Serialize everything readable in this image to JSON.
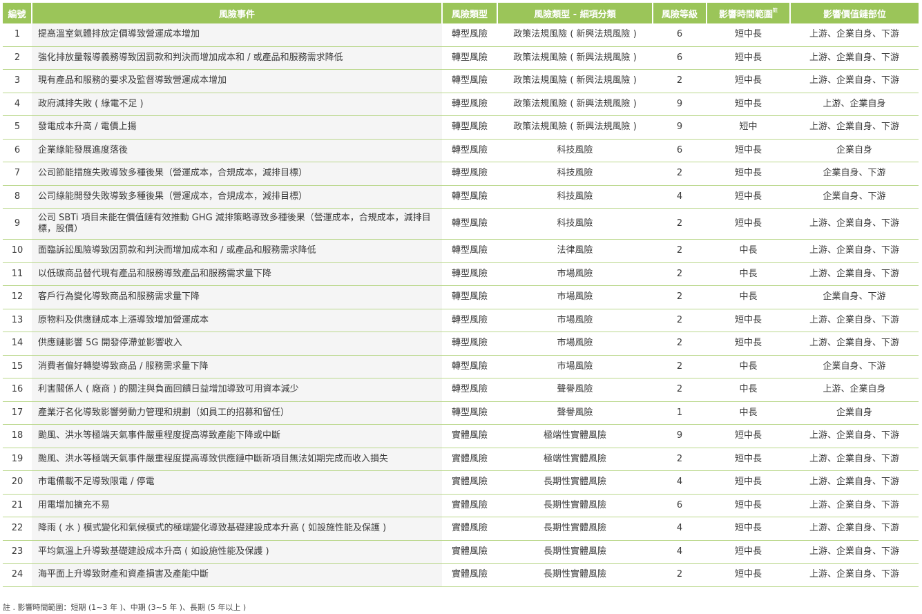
{
  "table": {
    "headers": {
      "no": "編號",
      "event": "風險事件",
      "type": "風險類型",
      "subtype": "風險類型 - 細項分類",
      "level": "風險等級",
      "time": "影響時間範圍",
      "time_mark": "註",
      "chain": "影響價值鏈部位"
    },
    "rows": [
      {
        "no": "1",
        "event": "提高溫室氣體排放定價導致營運成本增加",
        "type": "轉型風險",
        "subtype": "政策法規風險 ( 新興法規風險 )",
        "level": "6",
        "time": "短中長",
        "chain": "上游、企業自身、下游"
      },
      {
        "no": "2",
        "event": "強化排放量報導義務導致因罰款和判決而增加成本和 / 或產品和服務需求降低",
        "type": "轉型風險",
        "subtype": "政策法規風險 ( 新興法規風險 )",
        "level": "6",
        "time": "短中長",
        "chain": "上游、企業自身、下游"
      },
      {
        "no": "3",
        "event": "現有產品和服務的要求及監督導致營運成本增加",
        "type": "轉型風險",
        "subtype": "政策法規風險 ( 新興法規風險 )",
        "level": "2",
        "time": "短中長",
        "chain": "上游、企業自身、下游"
      },
      {
        "no": "4",
        "event": "政府減排失敗 ( 綠電不足 )",
        "type": "轉型風險",
        "subtype": "政策法規風險 ( 新興法規風險 )",
        "level": "9",
        "time": "短中長",
        "chain": "上游、企業自身"
      },
      {
        "no": "5",
        "event": "發電成本升高 / 電價上揚",
        "type": "轉型風險",
        "subtype": "政策法規風險 ( 新興法規風險 )",
        "level": "9",
        "time": "短中",
        "chain": "上游、企業自身、下游"
      },
      {
        "no": "6",
        "event": "企業綠能發展進度落後",
        "type": "轉型風險",
        "subtype": "科技風險",
        "level": "6",
        "time": "短中長",
        "chain": "企業自身"
      },
      {
        "no": "7",
        "event": "公司節能措施失敗導致多種後果（營運成本，合規成本，減排目標）",
        "type": "轉型風險",
        "subtype": "科技風險",
        "level": "2",
        "time": "短中長",
        "chain": "企業自身、下游"
      },
      {
        "no": "8",
        "event": "公司綠能開發失敗導致多種後果（營運成本，合規成本，減排目標）",
        "type": "轉型風險",
        "subtype": "科技風險",
        "level": "4",
        "time": "短中長",
        "chain": "企業自身、下游"
      },
      {
        "no": "9",
        "event": "公司 SBTi 項目未能在價值鏈有效推動 GHG 減排策略導致多種後果（營運成本，合規成本，減排目標，股價）",
        "type": "轉型風險",
        "subtype": "科技風險",
        "level": "2",
        "time": "短中長",
        "chain": "上游、企業自身、下游"
      },
      {
        "no": "10",
        "event": "面臨訴訟風險導致因罰款和判決而增加成本和 / 或產品和服務需求降低",
        "type": "轉型風險",
        "subtype": "法律風險",
        "level": "2",
        "time": "中長",
        "chain": "上游、企業自身、下游"
      },
      {
        "no": "11",
        "event": "以低碳商品替代現有產品和服務導致產品和服務需求量下降",
        "type": "轉型風險",
        "subtype": "市場風險",
        "level": "2",
        "time": "中長",
        "chain": "上游、企業自身、下游"
      },
      {
        "no": "12",
        "event": "客戶行為變化導致商品和服務需求量下降",
        "type": "轉型風險",
        "subtype": "市場風險",
        "level": "2",
        "time": "中長",
        "chain": "企業自身、下游"
      },
      {
        "no": "13",
        "event": "原物料及供應鏈成本上漲導致增加營運成本",
        "type": "轉型風險",
        "subtype": "市場風險",
        "level": "2",
        "time": "短中長",
        "chain": "上游、企業自身、下游"
      },
      {
        "no": "14",
        "event": "供應鏈影響 5G 開發停滯並影響收入",
        "type": "轉型風險",
        "subtype": "市場風險",
        "level": "2",
        "time": "短中長",
        "chain": "上游、企業自身、下游"
      },
      {
        "no": "15",
        "event": "消費者偏好轉變導致商品 / 服務需求量下降",
        "type": "轉型風險",
        "subtype": "市場風險",
        "level": "2",
        "time": "中長",
        "chain": "企業自身、下游"
      },
      {
        "no": "16",
        "event": "利害關係人 ( 廠商 ) 的關注與負面回饋日益增加導致可用資本減少",
        "type": "轉型風險",
        "subtype": "聲譽風險",
        "level": "2",
        "time": "中長",
        "chain": "上游、企業自身"
      },
      {
        "no": "17",
        "event": "產業汙名化導致影響勞動力管理和規劃（如員工的招募和留任）",
        "type": "轉型風險",
        "subtype": "聲譽風險",
        "level": "1",
        "time": "中長",
        "chain": "企業自身"
      },
      {
        "no": "18",
        "event": "颱風、洪水等極端天氣事件嚴重程度提高導致產能下降或中斷",
        "type": "實體風險",
        "subtype": "極端性實體風險",
        "level": "9",
        "time": "短中長",
        "chain": "上游、企業自身、下游"
      },
      {
        "no": "19",
        "event": "颱風、洪水等極端天氣事件嚴重程度提高導致供應鏈中斷新項目無法如期完成而收入損失",
        "type": "實體風險",
        "subtype": "極端性實體風險",
        "level": "2",
        "time": "短中長",
        "chain": "上游、企業自身、下游"
      },
      {
        "no": "20",
        "event": "市電備載不足導致限電 / 停電",
        "type": "實體風險",
        "subtype": "長期性實體風險",
        "level": "4",
        "time": "短中長",
        "chain": "上游、企業自身、下游"
      },
      {
        "no": "21",
        "event": "用電增加擴充不易",
        "type": "實體風險",
        "subtype": "長期性實體風險",
        "level": "6",
        "time": "短中長",
        "chain": "上游、企業自身、下游"
      },
      {
        "no": "22",
        "event": "降雨 ( 水 ) 模式變化和氣候模式的極端變化導致基礎建設成本升高 ( 如設施性能及保護 )",
        "type": "實體風險",
        "subtype": "長期性實體風險",
        "level": "4",
        "time": "短中長",
        "chain": "上游、企業自身、下游"
      },
      {
        "no": "23",
        "event": "平均氣溫上升導致基礎建設成本升高 ( 如設施性能及保護 )",
        "type": "實體風險",
        "subtype": "長期性實體風險",
        "level": "4",
        "time": "短中長",
        "chain": "上游、企業自身、下游"
      },
      {
        "no": "24",
        "event": "海平面上升導致財產和資產損害及產能中斷",
        "type": "實體風險",
        "subtype": "長期性實體風險",
        "level": "2",
        "time": "短中長",
        "chain": "上游、企業自身、下游"
      }
    ]
  },
  "note": "註 . 影響時間範圍：短期 (1~3 年 )、中期 (3~5 年 )、長期 (5 年以上 )",
  "colors": {
    "header_bg": "#9bc559",
    "row_border": "#b9d78a",
    "event_bg": "#f5f5f5"
  }
}
